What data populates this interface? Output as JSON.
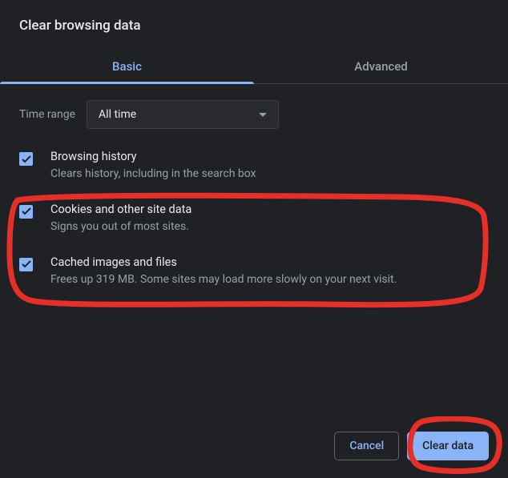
{
  "title": "Clear browsing data",
  "tabs": {
    "basic": "Basic",
    "advanced": "Advanced"
  },
  "time_range": {
    "label": "Time range",
    "value": "All time"
  },
  "options": [
    {
      "title": "Browsing history",
      "desc": "Clears history, including in the search box",
      "checked": true
    },
    {
      "title": "Cookies and other site data",
      "desc": "Signs you out of most sites.",
      "checked": true
    },
    {
      "title": "Cached images and files",
      "desc": "Frees up 319 MB. Some sites may load more slowly on your next visit.",
      "checked": true
    }
  ],
  "buttons": {
    "cancel": "Cancel",
    "clear": "Clear data"
  }
}
